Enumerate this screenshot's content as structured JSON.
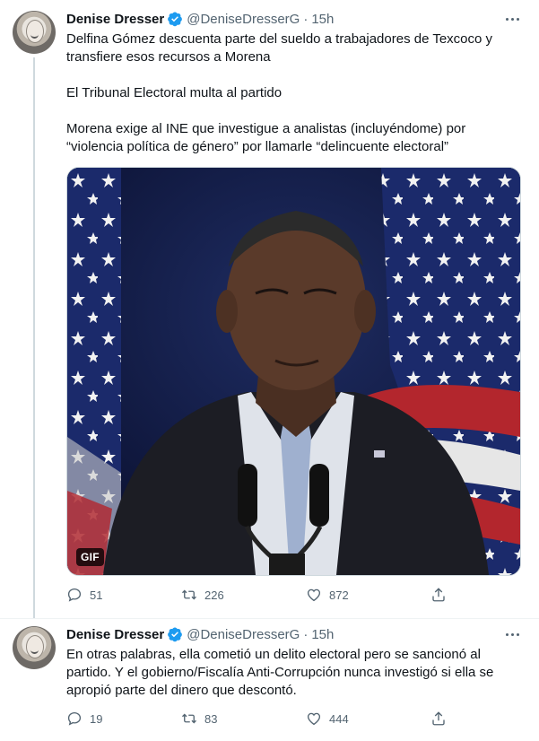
{
  "tweets": [
    {
      "name": "Denise Dresser",
      "handle": "@DeniseDresserG",
      "dot": "·",
      "time": "15h",
      "paragraphs": [
        "Delfina Gómez descuenta parte del sueldo a trabajadores de Texcoco y transfiere esos recursos a Morena",
        "El Tribunal Electoral multa al partido",
        "Morena exige al INE que investigue a analistas (incluyéndome) por “violencia política de género” por llamarle “delincuente electoral”"
      ],
      "media": {
        "badge": "GIF"
      },
      "replies": "51",
      "retweets": "226",
      "likes": "872"
    },
    {
      "name": "Denise Dresser",
      "handle": "@DeniseDresserG",
      "dot": "·",
      "time": "15h",
      "paragraphs": [
        "En otras palabras, ella cometió un delito electoral pero se sancionó al partido. Y el gobierno/Fiscalía Anti-Corrupción nunca investigó si ella se apropió parte del dinero que descontó."
      ],
      "replies": "19",
      "retweets": "83",
      "likes": "444"
    }
  ],
  "colors": {
    "accent": "#1d9bf0",
    "muted": "#536471",
    "text": "#0f1419"
  },
  "icons": [
    "verified-badge-icon",
    "more-icon",
    "reply-icon",
    "retweet-icon",
    "like-icon",
    "share-icon"
  ]
}
